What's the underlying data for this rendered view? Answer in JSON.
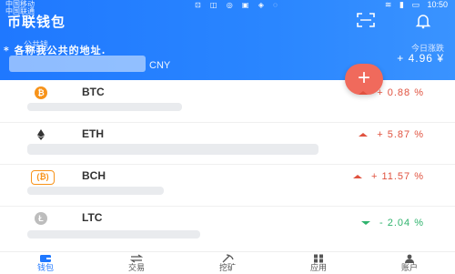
{
  "status_bar": {
    "carrier": "中国移动 中国联通",
    "time": "10:50"
  },
  "header": {
    "title": "币联钱包",
    "wallet_name": "公共钱",
    "address": "* 各称我公共的地址.",
    "currency": "CNY",
    "today_label": "今日涨跌",
    "today_value": "+ 4.96 ¥",
    "accent": "#1f78ff"
  },
  "fab": {
    "label": "+",
    "color": "#f06a5c"
  },
  "assets": [
    {
      "symbol": "BTC",
      "icon": "bitcoin-icon",
      "icon_color": "#f7931a",
      "change": "+ 0.88 %",
      "direction": "up"
    },
    {
      "symbol": "ETH",
      "icon": "ethereum-icon",
      "icon_color": "#333333",
      "change": "+ 5.87 %",
      "direction": "up"
    },
    {
      "symbol": "BCH",
      "icon": "bitcoin-cash-icon",
      "icon_color": "#f7931a",
      "change": "+ 11.57 %",
      "direction": "up"
    },
    {
      "symbol": "LTC",
      "icon": "litecoin-icon",
      "icon_color": "#bdbdbd",
      "change": "- 2.04 %",
      "direction": "down"
    }
  ],
  "bottom_nav": [
    {
      "label": "钱包",
      "icon": "wallet-icon",
      "active": true
    },
    {
      "label": "交易",
      "icon": "exchange-icon",
      "active": false
    },
    {
      "label": "挖矿",
      "icon": "mining-icon",
      "active": false
    },
    {
      "label": "应用",
      "icon": "apps-icon",
      "active": false
    },
    {
      "label": "账户",
      "icon": "account-icon",
      "active": false
    }
  ],
  "colors": {
    "up": "#e0523f",
    "down": "#2fb36d"
  }
}
